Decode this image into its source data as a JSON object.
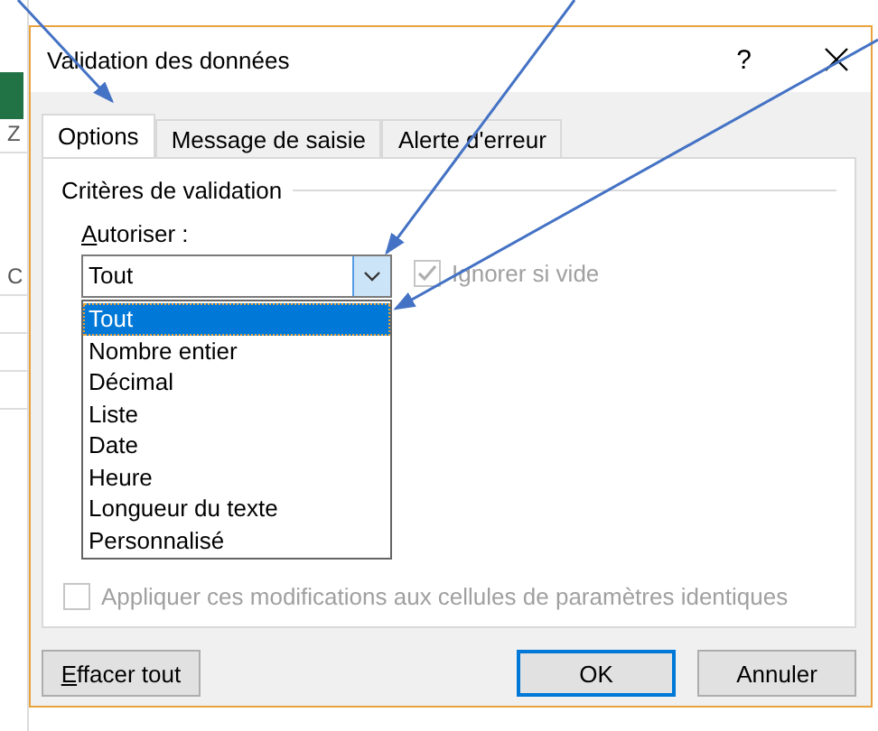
{
  "sheet_edge_texts": [
    "Z",
    "C"
  ],
  "dialog": {
    "title": "Validation des données",
    "help": "?",
    "tabs": [
      {
        "label": "Options",
        "selected": true
      },
      {
        "label": "Message de saisie",
        "selected": false
      },
      {
        "label": "Alerte d'erreur",
        "selected": false
      }
    ],
    "group_label": "Critères de validation",
    "allow": {
      "label": "Autoriser :",
      "value": "Tout",
      "expanded": true,
      "options": [
        {
          "label": "Tout",
          "selected": true
        },
        {
          "label": "Nombre entier",
          "selected": false
        },
        {
          "label": "Décimal",
          "selected": false
        },
        {
          "label": "Liste",
          "selected": false
        },
        {
          "label": "Date",
          "selected": false
        },
        {
          "label": "Heure",
          "selected": false
        },
        {
          "label": "Longueur du texte",
          "selected": false
        },
        {
          "label": "Personnalisé",
          "selected": false
        }
      ]
    },
    "ignore_blank": {
      "label": "Ignorer si vide",
      "checked": true,
      "disabled": true
    },
    "apply_all": {
      "label": "Appliquer ces modifications aux cellules de paramètres identiques",
      "checked": false,
      "disabled": true
    },
    "buttons": [
      {
        "label": "Effacer tout",
        "default": false
      },
      {
        "label": "OK",
        "default": true
      },
      {
        "label": "Annuler",
        "default": false
      }
    ]
  }
}
